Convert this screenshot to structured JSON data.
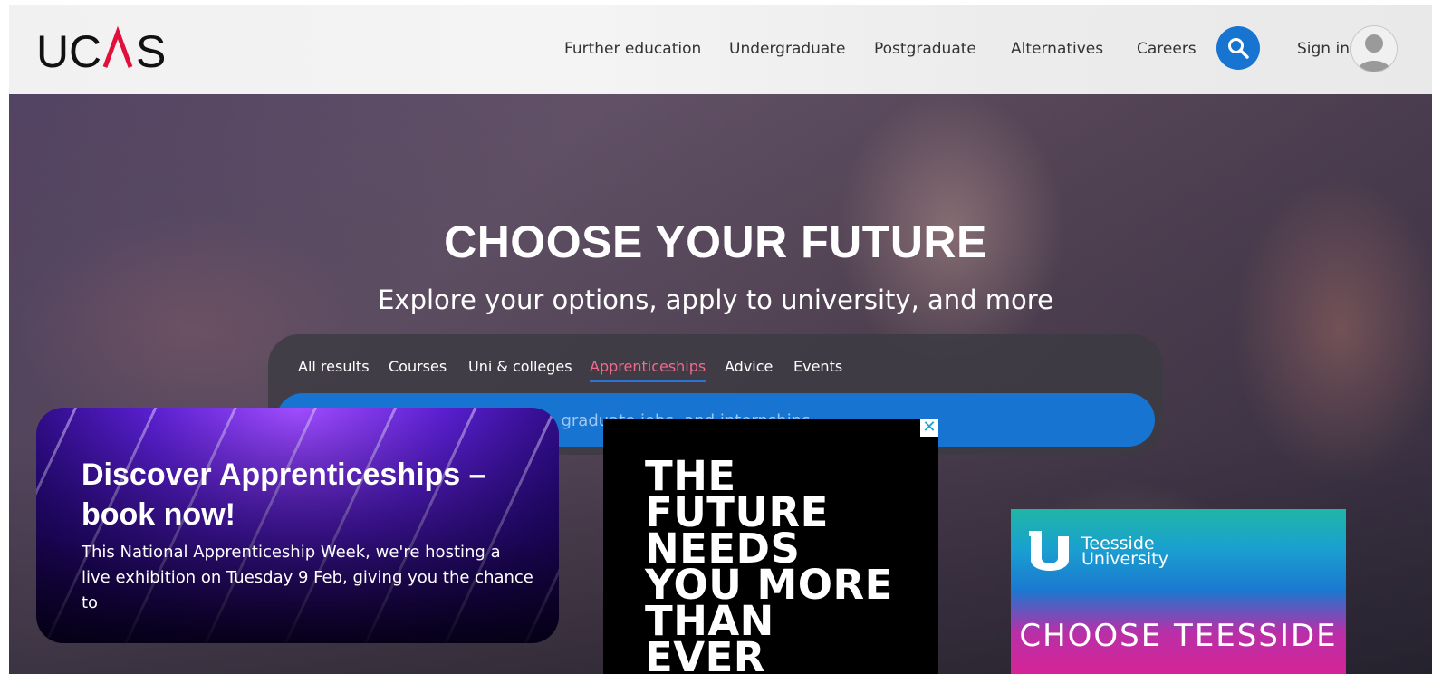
{
  "header": {
    "logo_text": "UCAS",
    "nav": [
      "Further education",
      "Undergraduate",
      "Postgraduate",
      "Alternatives",
      "Careers"
    ],
    "signin_label": "Sign in"
  },
  "hero": {
    "title": "CHOOSE YOUR FUTURE",
    "subtitle": "Explore your options, apply to university, and more",
    "tabs": [
      "All results",
      "Courses",
      "Uni & colleges",
      "Apprenticeships",
      "Advice",
      "Events"
    ],
    "active_tab": "Apprenticeships",
    "search_placeholder": "Search for apprenticeships, graduate jobs, and internships"
  },
  "promo": {
    "title": "Discover Apprenticeships – book now!",
    "body": "This National Apprenticeship Week, we're hosting a live exhibition on Tuesday 9 Feb, giving you the chance to"
  },
  "ads": {
    "black_ad_text": "THE FUTURE NEEDS YOU MORE THAN EVER",
    "close_glyph": "✕",
    "teesside_name": "Teesside University",
    "teesside_cta": "CHOOSE TEESSIDE"
  },
  "colors": {
    "accent_blue": "#1774d1",
    "active_tab": "#f06a8c"
  }
}
